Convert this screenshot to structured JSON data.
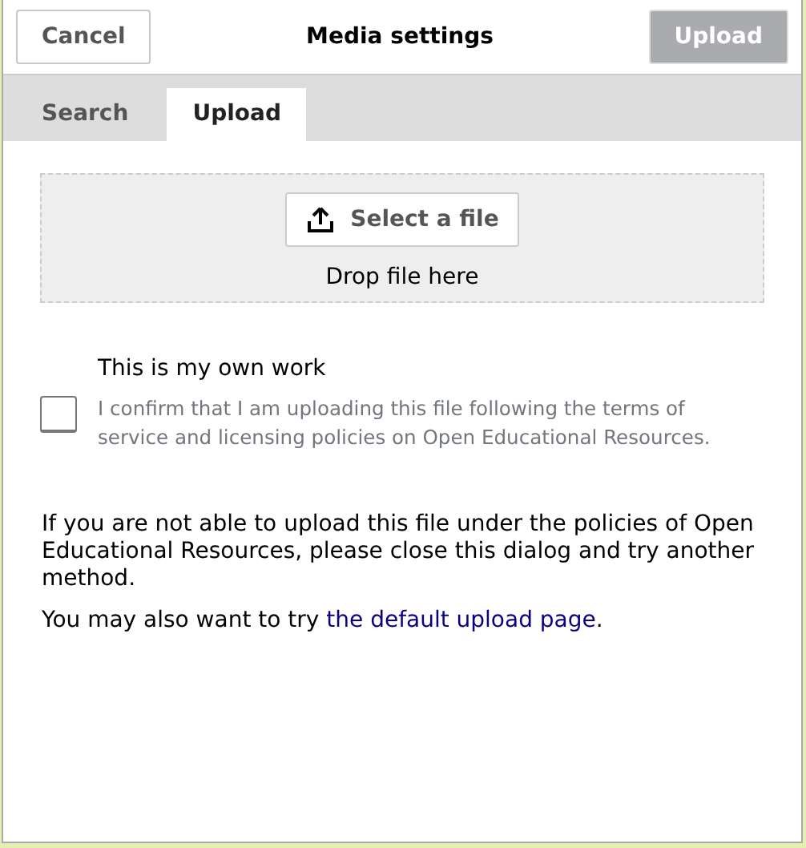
{
  "header": {
    "title": "Media settings",
    "cancel_button": "Cancel",
    "upload_button": {
      "label": "Upload",
      "disabled": true
    }
  },
  "tabs": [
    {
      "label": "Search",
      "selected": false
    },
    {
      "label": "Upload",
      "selected": true
    }
  ],
  "dropzone": {
    "button": "Select a file",
    "hint": "Drop file here"
  },
  "own_work": {
    "label": "This is my own work",
    "checked": false,
    "description": "I confirm that I am uploading this file following the terms of service and licensing policies on Open Educational Resources."
  },
  "notice": "If you are not able to upload this file under the policies of Open Educational Resources, please close this dialog and try another method.",
  "alternative": {
    "text": "You may also want to try ",
    "link": "the default upload page",
    "after": "."
  }
}
